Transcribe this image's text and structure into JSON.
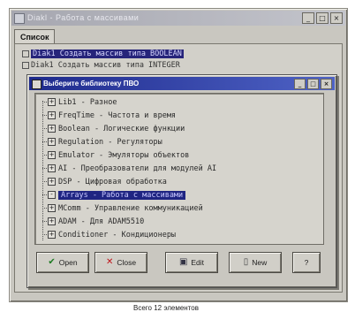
{
  "window": {
    "title": "Diakl - Работа с массивами",
    "tab_label": "Список",
    "background_rows": [
      {
        "label": "Diak1  Создать массив типа BOOLEAN",
        "selected": true
      },
      {
        "label": "Diak1  Создать массив типа INTEGER",
        "selected": false
      }
    ],
    "status": "Всего 12 элементов"
  },
  "dialog": {
    "title": "Выберите библиотеку ПВО",
    "items": [
      {
        "label": "Lib1 - Разное",
        "expander": "+",
        "selected": false
      },
      {
        "label": "FreqTime - Частота и время",
        "expander": "+",
        "selected": false
      },
      {
        "label": "Boolean - Логические функции",
        "expander": "+",
        "selected": false
      },
      {
        "label": "Regulation - Регуляторы",
        "expander": "+",
        "selected": false
      },
      {
        "label": "Emulator - Эмуляторы объектов",
        "expander": "+",
        "selected": false
      },
      {
        "label": "AI - Преобразователи для модулей AI",
        "expander": "+",
        "selected": false
      },
      {
        "label": "DSP - Цифровая обработка",
        "expander": "+",
        "selected": false
      },
      {
        "label": "Arrays - Работа с массивами",
        "expander": "-",
        "selected": true
      },
      {
        "label": "MComm - Управление коммуникацией",
        "expander": "+",
        "selected": false
      },
      {
        "label": "ADAM - Для ADAM5510",
        "expander": "+",
        "selected": false
      },
      {
        "label": "Conditioner - Кондиционеры",
        "expander": "+",
        "selected": false
      }
    ],
    "buttons": {
      "open": "Open",
      "close": "Close",
      "edit": "Edit",
      "new": "New",
      "help": "?"
    }
  },
  "icons": {
    "open": "check-icon",
    "close": "x-icon",
    "edit": "edit-icon",
    "new": "new-doc-icon"
  },
  "colors": {
    "dialog_title": "#1e2a8c",
    "selection": "#1f2582"
  }
}
